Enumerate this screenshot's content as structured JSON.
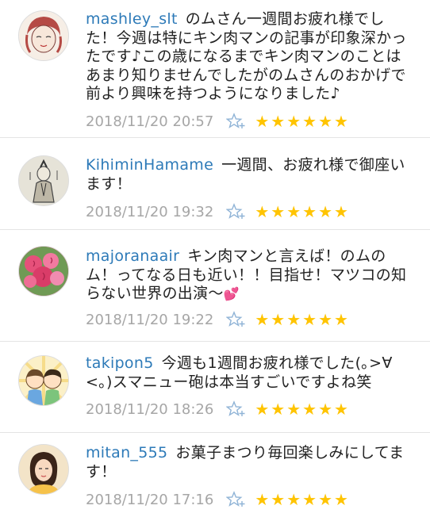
{
  "comments": [
    {
      "username": "mashley_slt",
      "text": "のムさん一週間お疲れ様でした！今週は特にキン肉マンの記事が印象深かったです♪この歳になるまでキン肉マンのことはあまり知りませんでしたがのムさんのおかげで前より興味を持つようになりました♪",
      "timestamp": "2018/11/20 20:57",
      "stars": "★★★★★★",
      "avatar_icon": "avatar-illustration"
    },
    {
      "username": "KihiminHamame",
      "text": "一週間、お疲れ様で御座います！",
      "timestamp": "2018/11/20 19:32",
      "stars": "★★★★★★",
      "avatar_icon": "avatar-samurai-drawing"
    },
    {
      "username": "majoranaair",
      "text": "キン肉マンと言えば！のムのム！ってなる日も近い！！目指せ！マツコの知らない世界の出演〜",
      "heart": "💕",
      "timestamp": "2018/11/20 19:22",
      "stars": "★★★★★★",
      "avatar_icon": "avatar-roses"
    },
    {
      "username": "takipon5",
      "text": "今週も1週間お疲れ様でした(｡>∀<｡)スマニュー砲は本当すごいですよね笑",
      "timestamp": "2018/11/20 18:26",
      "stars": "★★★★★★",
      "avatar_icon": "avatar-cartoon-couple"
    },
    {
      "username": "mitan_555",
      "text": "お菓子まつり毎回楽しみにしてます！",
      "timestamp": "2018/11/20 17:16",
      "stars": "★★★★★★",
      "avatar_icon": "avatar-woman-photo"
    }
  ],
  "colors": {
    "username": "#2d7ab8",
    "timestamp": "#a6a6a6",
    "star_fill": "#ffc400",
    "add_star_icon": "#8fb3d6"
  }
}
